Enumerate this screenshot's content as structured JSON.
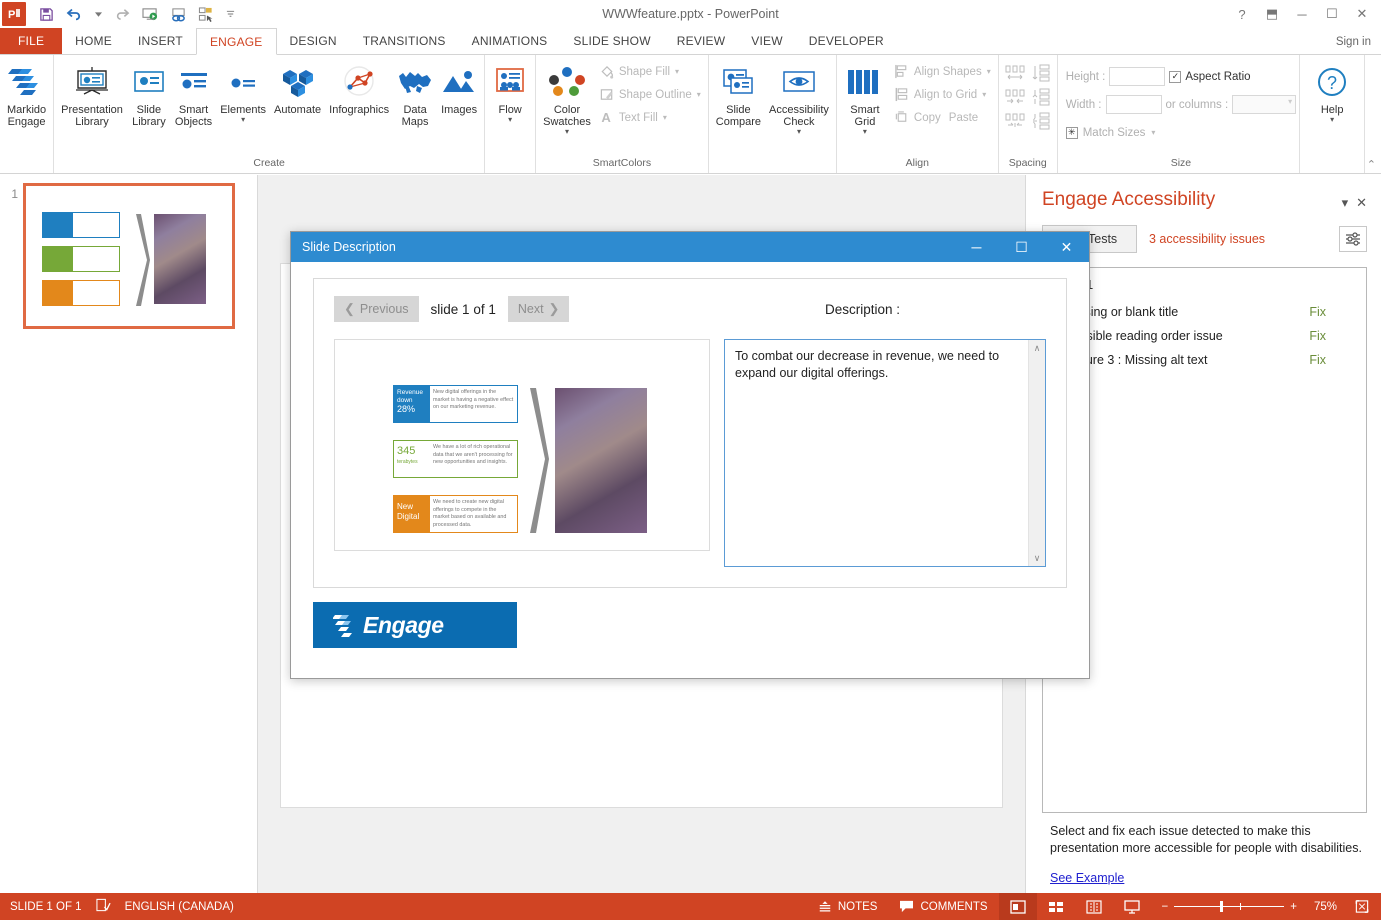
{
  "app": {
    "document_title": "WWWfeature.pptx - PowerPoint",
    "logo_text": "P",
    "sign_in": "Sign in"
  },
  "quick_access": [
    {
      "name": "save-icon",
      "glyph": "💾"
    },
    {
      "name": "undo-icon",
      "glyph": "↶"
    },
    {
      "name": "undo-dropdown-icon",
      "glyph": "▾"
    },
    {
      "name": "redo-icon",
      "glyph": "↻"
    },
    {
      "name": "start-presentation-icon",
      "glyph": "▷"
    },
    {
      "name": "link-icon",
      "glyph": "∞"
    },
    {
      "name": "customize-icon",
      "glyph": "▤"
    },
    {
      "name": "more-icon",
      "glyph": "≡"
    }
  ],
  "window_controls": [
    {
      "name": "help-icon",
      "glyph": "?"
    },
    {
      "name": "ribbon-display-options-icon",
      "glyph": "⬒"
    },
    {
      "name": "minimize-icon",
      "glyph": "─"
    },
    {
      "name": "restore-icon",
      "glyph": "☐"
    },
    {
      "name": "close-icon",
      "glyph": "✕"
    }
  ],
  "tabs": [
    {
      "label": "FILE",
      "active": false,
      "file": true
    },
    {
      "label": "HOME",
      "active": false
    },
    {
      "label": "INSERT",
      "active": false
    },
    {
      "label": "ENGAGE",
      "active": true
    },
    {
      "label": "DESIGN",
      "active": false
    },
    {
      "label": "TRANSITIONS",
      "active": false
    },
    {
      "label": "ANIMATIONS",
      "active": false
    },
    {
      "label": "SLIDE SHOW",
      "active": false
    },
    {
      "label": "REVIEW",
      "active": false
    },
    {
      "label": "VIEW",
      "active": false
    },
    {
      "label": "DEVELOPER",
      "active": false
    }
  ],
  "ribbon": {
    "collapse_glyph": "⌃",
    "groups": [
      {
        "label": "",
        "buttons": [
          {
            "name": "markido-engage-button",
            "label": "Markido\nEngage",
            "icon": "markido-logo-icon",
            "caret": false
          }
        ]
      },
      {
        "label": "Create",
        "buttons": [
          {
            "name": "presentation-library-button",
            "label": "Presentation\nLibrary",
            "icon": "presentation-library-icon",
            "caret": false
          },
          {
            "name": "slide-library-button",
            "label": "Slide\nLibrary",
            "icon": "slide-library-icon",
            "caret": false
          },
          {
            "name": "smart-objects-button",
            "label": "Smart\nObjects",
            "icon": "smart-objects-icon",
            "caret": false
          },
          {
            "name": "elements-button",
            "label": "Elements",
            "icon": "elements-icon",
            "caret": true
          },
          {
            "name": "automate-button",
            "label": "Automate",
            "icon": "automate-icon",
            "caret": false
          },
          {
            "name": "infographics-button",
            "label": "Infographics",
            "icon": "infographics-icon",
            "caret": false
          },
          {
            "name": "data-maps-button",
            "label": "Data\nMaps",
            "icon": "data-maps-icon",
            "caret": false
          },
          {
            "name": "images-button",
            "label": "Images",
            "icon": "images-icon",
            "caret": false
          }
        ]
      },
      {
        "label": "",
        "buttons": [
          {
            "name": "flow-button",
            "label": "Flow",
            "icon": "flow-icon",
            "caret": true
          }
        ]
      },
      {
        "label": "SmartColors",
        "buttons": [
          {
            "name": "color-swatches-button",
            "label": "Color\nSwatches",
            "icon": "color-swatches-icon",
            "caret": true
          }
        ],
        "small_buttons": [
          {
            "name": "shape-fill-button",
            "label": "Shape Fill",
            "icon": "paint-bucket-icon",
            "enabled": false,
            "caret": true
          },
          {
            "name": "shape-outline-button",
            "label": "Shape Outline",
            "icon": "pencil-outline-icon",
            "enabled": false,
            "caret": true
          },
          {
            "name": "text-fill-button",
            "label": "Text Fill",
            "icon": "text-fill-icon",
            "enabled": false,
            "caret": true
          }
        ]
      },
      {
        "label": "",
        "buttons": [
          {
            "name": "slide-compare-button",
            "label": "Slide\nCompare",
            "icon": "slide-compare-icon",
            "caret": false
          },
          {
            "name": "accessibility-check-button",
            "label": "Accessibility\nCheck",
            "icon": "eye-icon",
            "caret": true
          }
        ]
      },
      {
        "label": "Align",
        "buttons": [
          {
            "name": "smart-grid-button",
            "label": "Smart\nGrid",
            "icon": "smart-grid-icon",
            "caret": true
          }
        ],
        "small_buttons": [
          {
            "name": "align-shapes-button",
            "label": "Align Shapes",
            "icon": "align-shapes-icon",
            "enabled": false,
            "caret": true
          },
          {
            "name": "align-to-grid-button",
            "label": "Align to Grid",
            "icon": "align-to-grid-icon",
            "enabled": false,
            "caret": true
          },
          {
            "name": "copy-button",
            "label": "Copy",
            "icon": "copy-icon",
            "enabled": false,
            "caret": false
          },
          {
            "name": "paste-button",
            "label": "Paste",
            "icon": "paste-icon",
            "enabled": false,
            "caret": false
          }
        ]
      },
      {
        "label": "Spacing",
        "spacing_icons": [
          "distribute-horizontal-icon",
          "distribute-vertical-icon",
          "space-increase-horizontal-icon",
          "space-increase-vertical-icon",
          "space-decrease-horizontal-icon",
          "space-decrease-vertical-icon"
        ]
      },
      {
        "label": "Size",
        "size_fields": {
          "height_label": "Height :",
          "height_value": "",
          "width_label": "Width :",
          "width_value": "",
          "match_sizes_label": "Match Sizes",
          "aspect_ratio_label": "Aspect Ratio",
          "aspect_ratio_checked": true,
          "or_columns_label": "or columns :",
          "columns_value": ""
        }
      },
      {
        "label": "",
        "buttons": [
          {
            "name": "help-button",
            "label": "Help",
            "icon": "help-circle-icon",
            "caret": true
          }
        ]
      }
    ]
  },
  "thumbnail_pane": {
    "slides": [
      {
        "number": "1",
        "selected": true
      }
    ]
  },
  "slide_content": {
    "cards": [
      {
        "badge_lines": [
          "Revenue",
          "down",
          "28%"
        ],
        "body": "New digital offerings in the market is having a negative effect on our marketing revenue.",
        "color": "#1f7fc0",
        "border": "#1f7fc0"
      },
      {
        "badge_lines": [
          "345",
          "terabytes"
        ],
        "body": "We have a lot of rich operational data that we aren't processing for new opportunities and insights.",
        "color": "#76a838",
        "border": "#76a838"
      },
      {
        "badge_lines": [
          "New",
          "Digital"
        ],
        "body": "We need to create new digital offerings to compete in the market based on available and processed data.",
        "color": "#e3881b",
        "border": "#e3881b"
      }
    ],
    "chevron_color": "#8d8d8d",
    "photo_alt": "industrial-machinery-photo"
  },
  "dialog": {
    "title": "Slide Description",
    "controls": [
      {
        "name": "dialog-minimize-icon",
        "glyph": "─"
      },
      {
        "name": "dialog-maximize-icon",
        "glyph": "☐"
      },
      {
        "name": "dialog-close-icon",
        "glyph": "✕"
      }
    ],
    "previous_label": "Previous",
    "next_label": "Next",
    "slide_counter": "slide 1 of 1",
    "description_label": "Description :",
    "description_value": "To combat our decrease in revenue, we need to expand our digital offerings.",
    "scroll_up_glyph": "∧",
    "scroll_down_glyph": "∨",
    "logo_text": "Engage"
  },
  "accessibility_panel": {
    "title": "Engage Accessibility",
    "dropdown_glyph": "▾",
    "close_glyph": "✕",
    "run_tests_label": "Run Tests",
    "issue_count": "3 accessibility issues",
    "filter_icon": "filter-settings-icon",
    "group_label": "Slide 1",
    "issues": [
      {
        "text": "Missing or blank title",
        "visible_text": "ng or blank title",
        "action": "Fix"
      },
      {
        "text": "Possible reading order issue",
        "visible_text": "ble reading order issue",
        "action": "Fix"
      },
      {
        "text": "Picture 3 : Missing alt text",
        "visible_text": "e 3 : Missing alt text",
        "action": "Fix"
      }
    ],
    "footer_text": "Select and fix each issue detected to make this presentation more accessible for people with disabilities.",
    "see_example_label": "See Example"
  },
  "status_bar": {
    "slide_indicator": "SLIDE 1 OF 1",
    "proofing_icon": "spell-check-icon",
    "language": "ENGLISH (CANADA)",
    "notes_label": "NOTES",
    "notes_icon": "notes-icon",
    "comments_label": "COMMENTS",
    "comments_icon": "comment-icon",
    "views": [
      {
        "name": "normal-view-button",
        "icon": "normal-view-icon",
        "active": true
      },
      {
        "name": "slide-sorter-view-button",
        "icon": "slide-sorter-icon",
        "active": false
      },
      {
        "name": "reading-view-button",
        "icon": "reading-view-icon",
        "active": false
      },
      {
        "name": "slideshow-view-button",
        "icon": "slideshow-icon",
        "active": false
      }
    ],
    "zoom_out_glyph": "−",
    "zoom_in_glyph": "+",
    "zoom_level": "75%",
    "fit_slide_icon": "fit-to-window-icon"
  },
  "colors": {
    "accent_red": "#d04423",
    "dialog_blue": "#2e8bd0",
    "engage_blue": "#0b6cb1",
    "fix_green": "#6a8d3a",
    "link_blue": "#2020cf"
  }
}
